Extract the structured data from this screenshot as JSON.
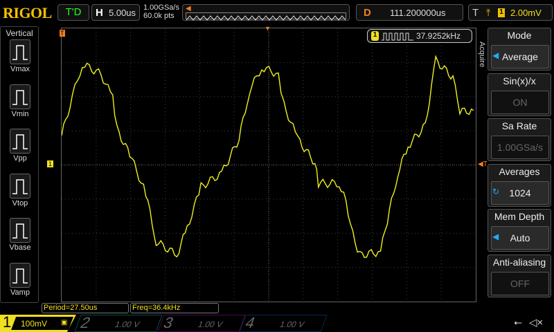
{
  "header": {
    "logo": "RIGOL",
    "run_status": "T'D",
    "horizontal_key": "H",
    "timebase": "5.00us",
    "sample_rate": "1.00GSa/s",
    "memory_points": "60.0k pts",
    "delay_key": "D",
    "delay": "111.200000us",
    "trigger_key": "T",
    "trigger_edge": "rising-edge-icon",
    "trigger_source": "1",
    "trigger_level": "2.00mV"
  },
  "left_menu": {
    "title": "Vertical",
    "items": [
      {
        "label": "Vmax"
      },
      {
        "label": "Vmin"
      },
      {
        "label": "Vpp"
      },
      {
        "label": "Vtop"
      },
      {
        "label": "Vbase"
      },
      {
        "label": "Vamp"
      }
    ]
  },
  "right_menu": {
    "side_label": "Acquire",
    "items": [
      {
        "title": "Mode",
        "value": "Average"
      },
      {
        "title": "Sin(x)/x",
        "value": "ON"
      },
      {
        "title": "Sa Rate",
        "value": "1.00GSa/s"
      },
      {
        "title": "Averages",
        "value": "1024"
      },
      {
        "title": "Mem Depth",
        "value": "Auto"
      },
      {
        "title": "Anti-aliasing",
        "value": "OFF"
      }
    ]
  },
  "freq_counter": {
    "channel": "1",
    "value": "37.9252kHz"
  },
  "measurements": {
    "period": "Period=27.50us",
    "freq": "Freq=36.4kHz"
  },
  "channels": [
    {
      "num": "1",
      "scale": "100mV",
      "color": "#f0e020"
    },
    {
      "num": "2",
      "scale": "1.00 V",
      "color": "#00a0a0"
    },
    {
      "num": "3",
      "scale": "1.00 V",
      "color": "#c020c0"
    },
    {
      "num": "4",
      "scale": "1.00 V",
      "color": "#2070d0"
    }
  ],
  "trace": {
    "color": "#f0f020",
    "time_per_div_us": 5,
    "volts_per_div_mV": 100,
    "points_us_mV": [
      [
        0,
        86
      ],
      [
        1.2,
        176
      ],
      [
        3,
        296
      ],
      [
        5.7,
        266
      ],
      [
        7.4,
        196
      ],
      [
        8,
        106
      ],
      [
        10.2,
        16
      ],
      [
        12.2,
        -84
      ],
      [
        13.7,
        -224
      ],
      [
        16.7,
        -264
      ],
      [
        18.2,
        -184
      ],
      [
        20.2,
        -64
      ],
      [
        23.2,
        -24
      ],
      [
        25.7,
        76
      ],
      [
        27.2,
        216
      ],
      [
        29,
        286
      ],
      [
        31.4,
        266
      ],
      [
        32.2,
        176
      ],
      [
        34.2,
        76
      ],
      [
        36.7,
        6
      ],
      [
        37.2,
        -54
      ],
      [
        40.2,
        -54
      ],
      [
        41.2,
        -104
      ],
      [
        42.2,
        -204
      ],
      [
        43.2,
        -264
      ],
      [
        46.2,
        -254
      ],
      [
        47.2,
        -164
      ],
      [
        48.7,
        -24
      ],
      [
        50.2,
        56
      ],
      [
        52.7,
        116
      ],
      [
        54.2,
        306
      ],
      [
        56.7,
        256
      ],
      [
        57.7,
        156
      ],
      [
        59.7,
        160
      ]
    ]
  }
}
